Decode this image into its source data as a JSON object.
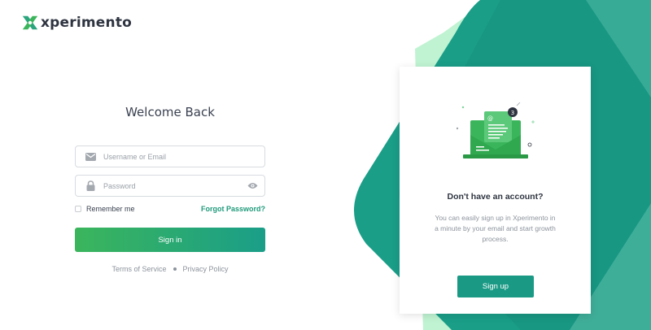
{
  "brand": {
    "name": "xperimento",
    "accent": "#1f9a7a",
    "accent_light": "#3bb55c",
    "accent_dark": "#1a9e88"
  },
  "login": {
    "title": "Welcome Back",
    "username_placeholder": "Username or Email",
    "password_placeholder": "Password",
    "remember_label": "Remember me",
    "remember_checked": false,
    "forgot_label": "Forgot Password?",
    "signin_label": "Sign in"
  },
  "legal": {
    "terms_label": "Terms of Service",
    "privacy_label": "Privacy Policy"
  },
  "signup_card": {
    "badge_count": "3",
    "title": "Don't have an account?",
    "text": "You can easily sign up in Xperimento in a minute by your email and start growth process.",
    "signup_label": "Sign up"
  },
  "icons": {
    "logo": "x-logo-icon",
    "email": "envelope-icon",
    "password": "lock-icon",
    "toggle_password": "eye-icon",
    "illustration": "laptop-email-illustration"
  }
}
